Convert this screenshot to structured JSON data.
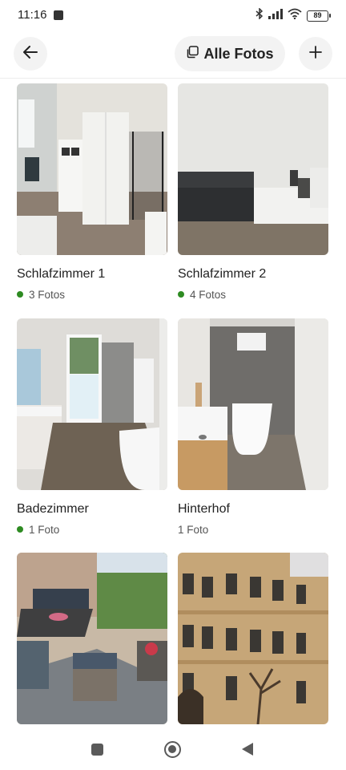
{
  "status_bar": {
    "time": "11:16",
    "battery": "89",
    "icons": [
      "notification-square-icon",
      "bluetooth-icon",
      "signal-icon",
      "wifi-icon",
      "battery-icon"
    ]
  },
  "header": {
    "back_icon": "arrow-left-icon",
    "all_photos_label": "Alle Fotos",
    "all_photos_icon": "photos-stack-icon",
    "add_icon": "plus-icon"
  },
  "rooms": [
    {
      "title": "Schlafzimmer 1",
      "count": "3 Fotos",
      "has_dot": true
    },
    {
      "title": "Schlafzimmer 2",
      "count": "4 Fotos",
      "has_dot": true
    },
    {
      "title": "Badezimmer",
      "count": "1 Foto",
      "has_dot": true
    },
    {
      "title": "Hinterhof",
      "count": "1 Foto",
      "has_dot": false
    }
  ],
  "colors": {
    "status_dot": "#2e8b22",
    "button_bg": "#f3f3f3"
  },
  "nav_bar": {
    "icons": [
      "recents-square-icon",
      "home-circle-icon",
      "back-triangle-icon"
    ]
  }
}
